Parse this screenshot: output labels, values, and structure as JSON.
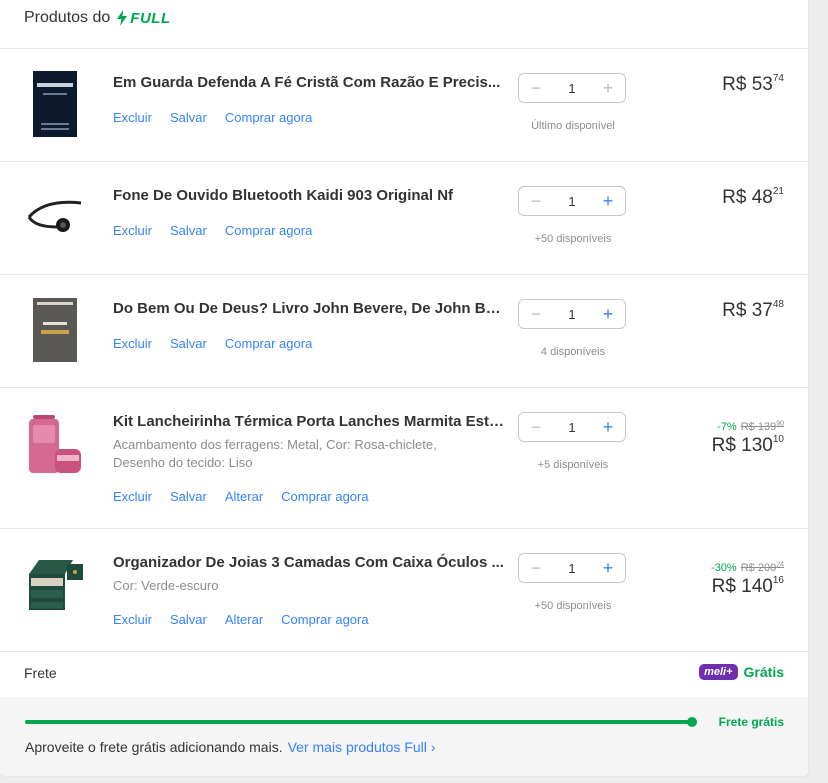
{
  "header": {
    "title": "Produtos do",
    "full_label": "FULL"
  },
  "items": [
    {
      "title": "Em Guarda Defenda A Fé Cristã Com Razão E Precis...",
      "variation": "",
      "actions": [
        "Excluir",
        "Salvar",
        "Comprar agora"
      ],
      "qty": "1",
      "stock": "Último disponível",
      "discount": "",
      "old_price": "",
      "old_cents": "",
      "price_main": "R$ 53",
      "price_cents": "74",
      "thumb_icon": "book-cover-dark"
    },
    {
      "title": "Fone De Ouvido Bluetooth Kaidi 903 Original Nf",
      "variation": "",
      "actions": [
        "Excluir",
        "Salvar",
        "Comprar agora"
      ],
      "qty": "1",
      "stock": "+50 disponíveis",
      "discount": "",
      "old_price": "",
      "old_cents": "",
      "price_main": "R$ 48",
      "price_cents": "21",
      "thumb_icon": "headphones"
    },
    {
      "title": "Do Bem Ou De Deus? Livro John Bevere, De John Be...",
      "variation": "",
      "actions": [
        "Excluir",
        "Salvar",
        "Comprar agora"
      ],
      "qty": "1",
      "stock": "4 disponíveis",
      "discount": "",
      "old_price": "",
      "old_cents": "",
      "price_main": "R$ 37",
      "price_cents": "48",
      "thumb_icon": "book-cover-grey"
    },
    {
      "title": "Kit Lancheirinha Térmica Porta Lanches Marmita Esto...",
      "variation": "Acambamento dos ferragens: Metal, Cor: Rosa-chiclete, Desenho do tecido: Liso",
      "actions": [
        "Excluir",
        "Salvar",
        "Alterar",
        "Comprar agora"
      ],
      "qty": "1",
      "stock": "+5 disponíveis",
      "discount": "-7%",
      "old_price": "R$ 139",
      "old_cents": "90",
      "price_main": "R$ 130",
      "price_cents": "10",
      "thumb_icon": "pink-lunch-kit"
    },
    {
      "title": "Organizador De Joias 3 Camadas Com Caixa Óculos ...",
      "variation": "Cor: Verde-escuro",
      "actions": [
        "Excluir",
        "Salvar",
        "Alterar",
        "Comprar agora"
      ],
      "qty": "1",
      "stock": "+50 disponíveis",
      "discount": "-30%",
      "old_price": "R$ 200",
      "old_cents": "24",
      "price_main": "R$ 140",
      "price_cents": "16",
      "thumb_icon": "jewelry-box"
    }
  ],
  "frete": {
    "label": "Frete",
    "badge": "meli+",
    "value": "Grátis"
  },
  "shipping": {
    "progress": 1.0,
    "bar_label": "Frete grátis",
    "promo_text": "Aproveite o frete grátis adicionando mais.",
    "promo_link": "Ver mais produtos Full ›"
  },
  "colors": {
    "accent": "#3483fa",
    "green": "#00a650",
    "meli_purple": "#6e2fb0"
  }
}
